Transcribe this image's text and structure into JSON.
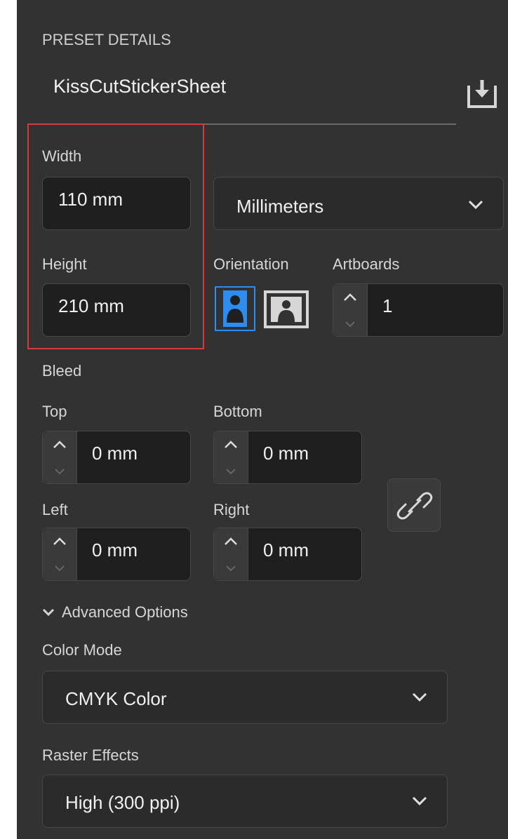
{
  "section_title": "PRESET DETAILS",
  "preset_name": "KissCutStickerSheet",
  "width": {
    "label": "Width",
    "value": "110 mm"
  },
  "height": {
    "label": "Height",
    "value": "210 mm"
  },
  "units": {
    "selected": "Millimeters"
  },
  "orientation": {
    "label": "Orientation",
    "selected": "portrait"
  },
  "artboards": {
    "label": "Artboards",
    "value": "1"
  },
  "bleed": {
    "label": "Bleed",
    "top": {
      "label": "Top",
      "value": "0 mm"
    },
    "bottom": {
      "label": "Bottom",
      "value": "0 mm"
    },
    "left": {
      "label": "Left",
      "value": "0 mm"
    },
    "right": {
      "label": "Right",
      "value": "0 mm"
    }
  },
  "advanced": {
    "label": "Advanced Options",
    "expanded": true
  },
  "color_mode": {
    "label": "Color Mode",
    "selected": "CMYK Color"
  },
  "raster_effects": {
    "label": "Raster Effects",
    "selected": "High (300 ppi)"
  },
  "colors": {
    "panel": "#323232",
    "accent": "#2d8cf0",
    "highlight_box": "#d63a3a"
  },
  "icons": [
    "save-preset-icon",
    "portrait-icon",
    "landscape-icon",
    "link-icon",
    "chevron-down-icon",
    "chevron-up-icon"
  ]
}
